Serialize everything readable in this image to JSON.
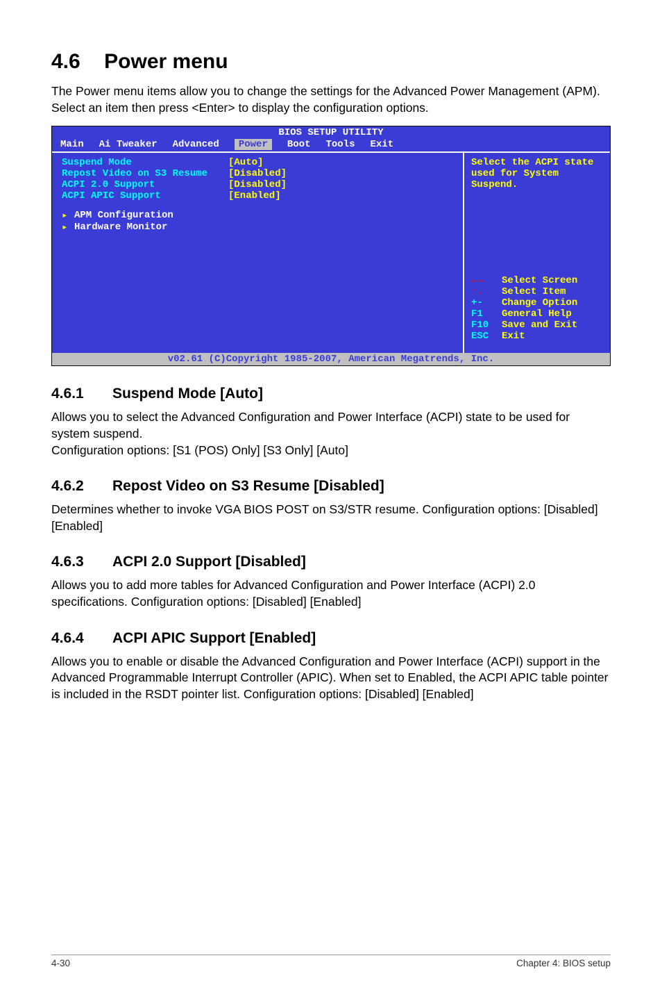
{
  "heading": {
    "num": "4.6",
    "title": "Power menu"
  },
  "intro": "The Power menu items allow you to change the settings for the Advanced Power Management (APM). Select an item then press <Enter> to display the configuration options.",
  "bios": {
    "title": "BIOS SETUP UTILITY",
    "tabs": [
      "Main",
      "Ai Tweaker",
      "Advanced",
      "Power",
      "Boot",
      "Tools",
      "Exit"
    ],
    "selectedTab": "Power",
    "left": {
      "rows": [
        {
          "label": "Suspend Mode",
          "value": "[Auto]"
        },
        {
          "label": "Repost Video on S3 Resume",
          "value": "[Disabled]"
        },
        {
          "label": "ACPI 2.0 Support",
          "value": "[Disabled]"
        },
        {
          "label": "ACPI APIC Support",
          "value": "[Enabled]"
        }
      ],
      "subs": [
        "APM Configuration",
        "Hardware Monitor"
      ]
    },
    "right": {
      "topLines": [
        "Select the ACPI state",
        "used for System",
        "Suspend."
      ],
      "help": [
        {
          "k": "←→",
          "v": "Select Screen",
          "kcol": "#ff0000",
          "vcol": "#ffff00"
        },
        {
          "k": "↑↓",
          "v": "Select Item",
          "kcol": "#ff0000",
          "vcol": "#ffff00"
        },
        {
          "k": "+-",
          "v": "Change Option",
          "kcol": "#00ffff",
          "vcol": "#ffff00"
        },
        {
          "k": "F1",
          "v": "General Help",
          "kcol": "#00ffff",
          "vcol": "#ffff00"
        },
        {
          "k": "F10",
          "v": "Save and Exit",
          "kcol": "#00ffff",
          "vcol": "#ffff00"
        },
        {
          "k": "ESC",
          "v": "Exit",
          "kcol": "#00ffff",
          "vcol": "#ffff00"
        }
      ]
    },
    "foot": "v02.61 (C)Copyright 1985-2007, American Megatrends, Inc."
  },
  "sec": [
    {
      "num": "4.6.1",
      "title": "Suspend Mode [Auto]",
      "paras": [
        "Allows you to select the Advanced Configuration and Power Interface (ACPI) state to be used for system suspend.",
        "Configuration options: [S1 (POS) Only] [S3 Only] [Auto]"
      ]
    },
    {
      "num": "4.6.2",
      "title": "Repost Video on S3 Resume [Disabled]",
      "paras": [
        "Determines whether to invoke VGA BIOS POST on S3/STR resume. Configuration options: [Disabled] [Enabled]"
      ]
    },
    {
      "num": "4.6.3",
      "title": "ACPI 2.0 Support [Disabled]",
      "paras": [
        "Allows you to add more tables for Advanced Configuration and Power Interface (ACPI) 2.0 specifications. Configuration options: [Disabled] [Enabled]"
      ]
    },
    {
      "num": "4.6.4",
      "title": "ACPI APIC Support [Enabled]",
      "paras": [
        "Allows you to enable or disable the Advanced Configuration and Power Interface (ACPI) support in the Advanced Programmable Interrupt Controller (APIC). When set to Enabled, the ACPI APIC table pointer is included in the RSDT pointer list. Configuration options: [Disabled] [Enabled]"
      ]
    }
  ],
  "footer": {
    "left": "4-30",
    "right": "Chapter 4: BIOS setup"
  }
}
